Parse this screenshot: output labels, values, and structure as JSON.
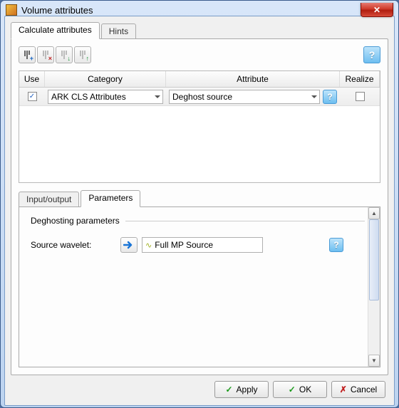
{
  "window": {
    "title": "Volume attributes"
  },
  "tabs": {
    "calculate": "Calculate attributes",
    "hints": "Hints"
  },
  "toolbar": {
    "help": "?"
  },
  "grid": {
    "headers": {
      "use": "Use",
      "category": "Category",
      "attribute": "Attribute",
      "realize": "Realize"
    },
    "rows": [
      {
        "use_checked": "✓",
        "category": "ARK CLS Attributes",
        "attribute": "Deghost source",
        "realize_checked": ""
      }
    ]
  },
  "lower_tabs": {
    "input_output": "Input/output",
    "parameters": "Parameters"
  },
  "params": {
    "group_title": "Deghosting  parameters",
    "source_wavelet_label": "Source wavelet:",
    "source_wavelet_value": "Full MP Source"
  },
  "footer": {
    "apply": "Apply",
    "ok": "OK",
    "cancel": "Cancel"
  }
}
